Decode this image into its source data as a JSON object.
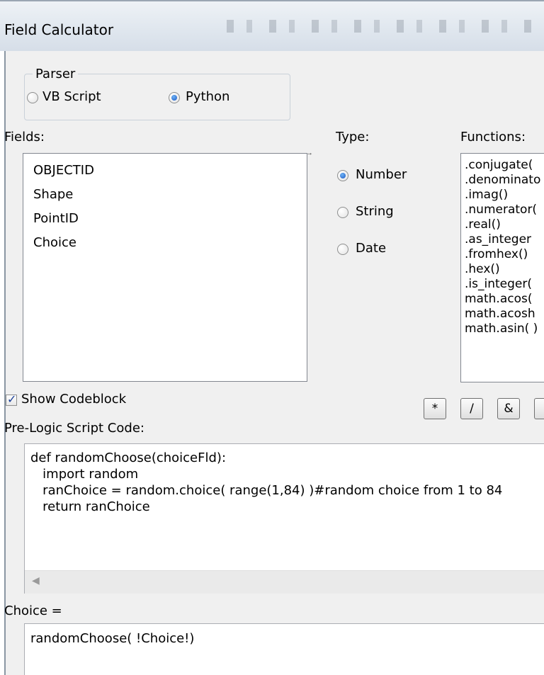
{
  "window": {
    "title": "Field Calculator"
  },
  "parser": {
    "legend": "Parser",
    "options": [
      {
        "label": "VB Script",
        "selected": false
      },
      {
        "label": "Python",
        "selected": true
      }
    ]
  },
  "fields": {
    "label": "Fields:",
    "items": [
      "OBJECTID",
      "Shape",
      "PointID",
      "Choice"
    ]
  },
  "type": {
    "label": "Type:",
    "options": [
      {
        "label": "Number",
        "selected": true
      },
      {
        "label": "String",
        "selected": false
      },
      {
        "label": "Date",
        "selected": false
      }
    ]
  },
  "functions": {
    "label": "Functions:",
    "items": [
      ".conjugate(",
      ".denominato",
      ".imag()",
      ".numerator(",
      ".real()",
      ".as_integer",
      ".fromhex()",
      ".hex()",
      ".is_integer(",
      "math.acos(",
      "math.acosh",
      "math.asin( )"
    ]
  },
  "codeblock": {
    "label": "Show Codeblock",
    "checked": true
  },
  "operators": [
    "*",
    "/",
    "&"
  ],
  "prelogic": {
    "label": "Pre-Logic Script Code:",
    "lines": [
      "def randomChoose(choiceFld):",
      "   import random",
      "   ranChoice = random.choice( range(1,84) )#random choice from 1 to 84",
      "   return ranChoice"
    ]
  },
  "expression": {
    "label": "Choice =",
    "value": "randomChoose( !Choice!)"
  },
  "icons": {
    "scroll_left": "scroll-left-arrow-icon",
    "sort": "sort-icon",
    "check": "checkmark-icon"
  }
}
